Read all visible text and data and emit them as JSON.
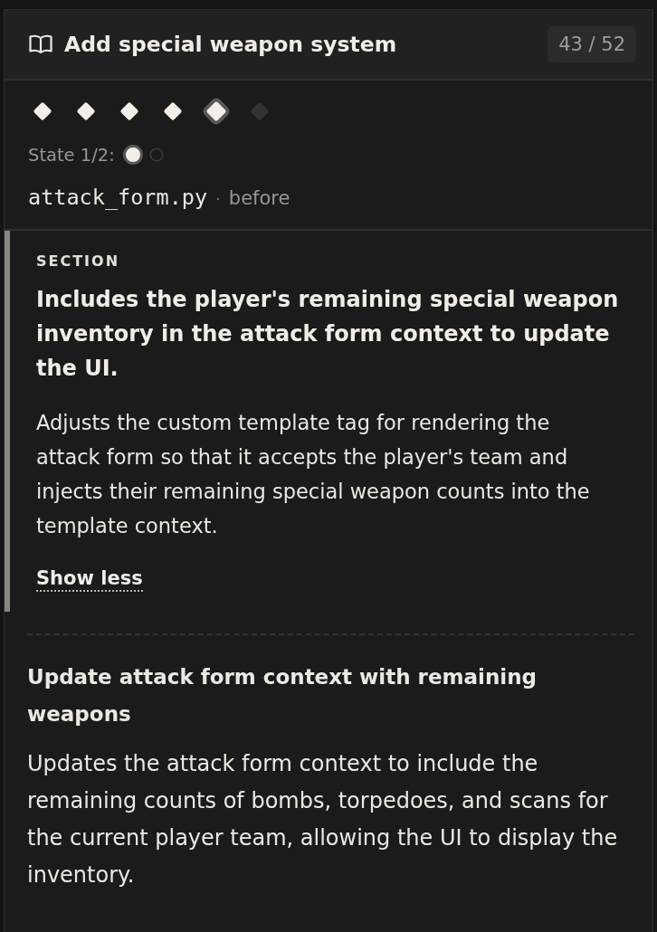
{
  "header": {
    "title": "Add special weapon system",
    "counter": "43 / 52"
  },
  "steps": [
    {
      "done": true,
      "selected": false
    },
    {
      "done": true,
      "selected": false
    },
    {
      "done": true,
      "selected": false
    },
    {
      "done": true,
      "selected": false
    },
    {
      "done": true,
      "selected": true
    },
    {
      "done": false,
      "selected": false
    }
  ],
  "state": {
    "label": "State 1/2:",
    "options": [
      {
        "selected": true
      },
      {
        "selected": false
      }
    ]
  },
  "file": {
    "name": "attack_form.py",
    "separator": "·",
    "version": "before"
  },
  "section": {
    "selected": true,
    "label": "SECTION",
    "title": "Includes the player's remaining special weapon inventory in the attack form context to update the UI.",
    "description": "Adjusts the custom template tag for rendering the attack form so that it accepts the player's team and injects their remaining special weapon counts into the template context.",
    "toggle": "Show less"
  },
  "changes": [
    {
      "title": "Update attack form context with remaining weapons",
      "description": "Updates the attack form context to include the remaining counts of bombs, torpedoes, and scans for the current player team, allowing the UI to display the inventory."
    }
  ]
}
